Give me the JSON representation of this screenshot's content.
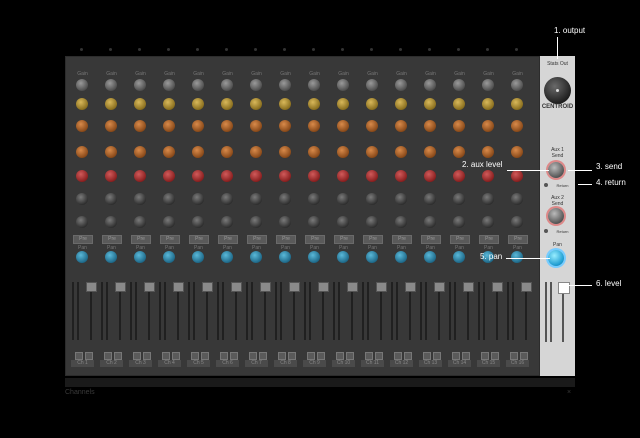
{
  "mixer": {
    "strip_labels": {
      "gain": "Gain",
      "pre": "Pre",
      "pan": "Pan"
    },
    "channels": [
      "Ch 1",
      "Ch 2",
      "Ch 3",
      "Ch 4",
      "Ch 5",
      "Ch 6",
      "Ch 7",
      "Ch 8",
      "Ch 9",
      "Ch 10",
      "Ch 11",
      "Ch 12",
      "Ch 13",
      "Ch 14",
      "Ch 15",
      "Ch 16"
    ],
    "mute": "M",
    "solo": "S"
  },
  "master": {
    "top_label": "Stats Out",
    "output_label": "CENTROID",
    "aux1_title": "Aux 1",
    "aux1_sub": "Send",
    "aux1_return": "Return",
    "aux2_title": "Aux 2",
    "aux2_sub": "Send",
    "aux2_return": "Return",
    "pan_label": "Pan"
  },
  "annotations": {
    "output": "1. output",
    "aux_level": "2. aux level",
    "send": "3. send",
    "return": "4. return",
    "pan": "5. pan",
    "level": "6. level"
  },
  "footer": {
    "title": "Channels",
    "close": "×"
  },
  "colors": {
    "cyan_accent": "#1a9ad0",
    "red_knob": "#8a2020",
    "yellow_knob": "#8a6f1f",
    "orange_knob": "#8a4a1a"
  }
}
